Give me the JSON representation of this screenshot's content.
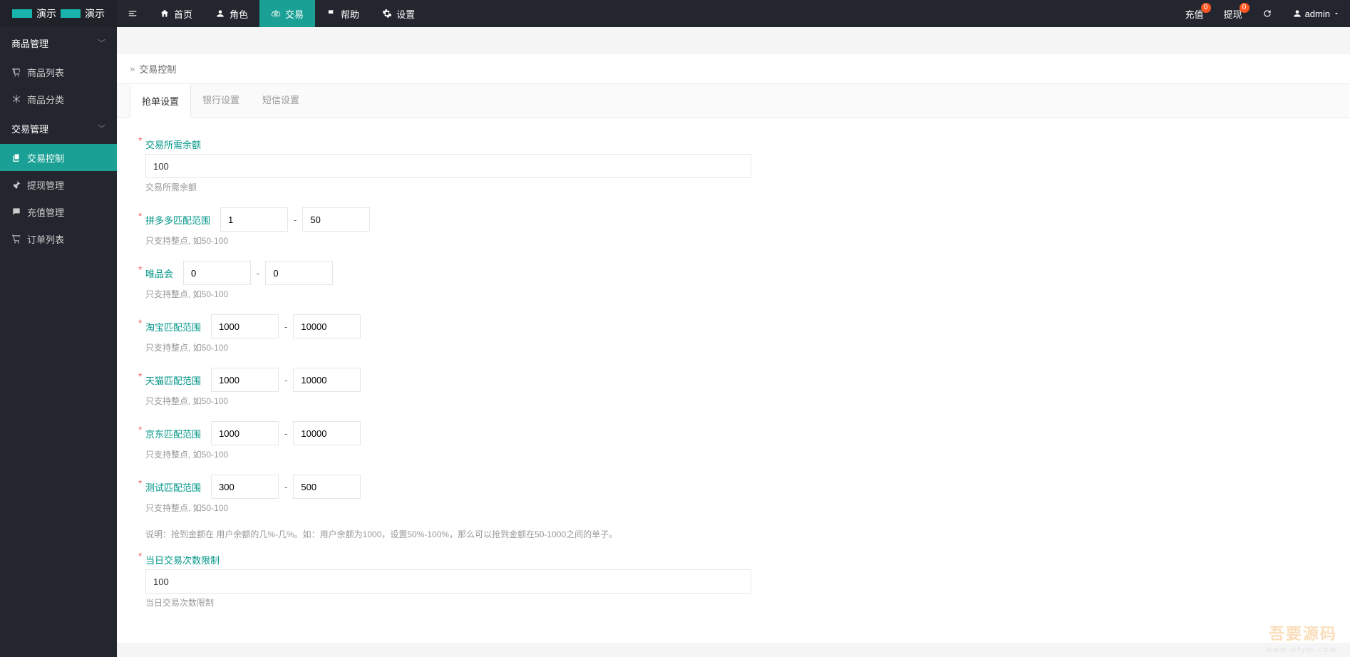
{
  "header": {
    "logo_parts": [
      "演示",
      "演示"
    ],
    "nav": [
      {
        "label": "首页",
        "icon": "home"
      },
      {
        "label": "角色",
        "icon": "user"
      },
      {
        "label": "交易",
        "icon": "scale",
        "active": true
      },
      {
        "label": "帮助",
        "icon": "flag"
      },
      {
        "label": "设置",
        "icon": "gear"
      }
    ],
    "right": {
      "recharge": {
        "label": "充值",
        "badge": "0"
      },
      "withdraw": {
        "label": "提现",
        "badge": "0"
      },
      "user": {
        "label": "admin"
      }
    }
  },
  "sidebar": {
    "groups": [
      {
        "label": "商品管理",
        "open": true,
        "items": [
          {
            "label": "商品列表",
            "icon": "cart"
          },
          {
            "label": "商品分类",
            "icon": "snow"
          }
        ]
      },
      {
        "label": "交易管理",
        "open": true,
        "items": [
          {
            "label": "交易控制",
            "icon": "copy",
            "active": true
          },
          {
            "label": "提现管理",
            "icon": "pin"
          },
          {
            "label": "充值管理",
            "icon": "chat"
          },
          {
            "label": "订单列表",
            "icon": "cart2"
          }
        ]
      }
    ]
  },
  "breadcrumb": {
    "title": "交易控制"
  },
  "tabs": [
    {
      "label": "抢单设置",
      "active": true
    },
    {
      "label": "银行设置"
    },
    {
      "label": "短信设置"
    }
  ],
  "form": {
    "balance": {
      "label": "交易所需余额",
      "value": "100",
      "help": "交易所需余额"
    },
    "ranges": [
      {
        "label": "拼多多匹配范围",
        "min": "1",
        "max": "50",
        "help": "只支持整点, 如50-100"
      },
      {
        "label": "唯品会",
        "min": "0",
        "max": "0",
        "help": "只支持整点, 如50-100"
      },
      {
        "label": "淘宝匹配范围",
        "min": "1000",
        "max": "10000",
        "help": "只支持整点, 如50-100"
      },
      {
        "label": "天猫匹配范围",
        "min": "1000",
        "max": "10000",
        "help": "只支持整点, 如50-100"
      },
      {
        "label": "京东匹配范围",
        "min": "1000",
        "max": "10000",
        "help": "只支持整点, 如50-100"
      },
      {
        "label": "测试匹配范围",
        "min": "300",
        "max": "500",
        "help": "只支持整点, 如50-100"
      }
    ],
    "note": "说明：抢到金额在 用户余额的几%-几%。如：用户余额为1000，设置50%-100%，那么可以抢到金额在50-1000之间的单子。",
    "daily_limit": {
      "label": "当日交易次数限制",
      "value": "100",
      "help": "当日交易次数限制"
    }
  },
  "watermark": {
    "main": "吾要源码",
    "sub": "www.wtym.com"
  }
}
